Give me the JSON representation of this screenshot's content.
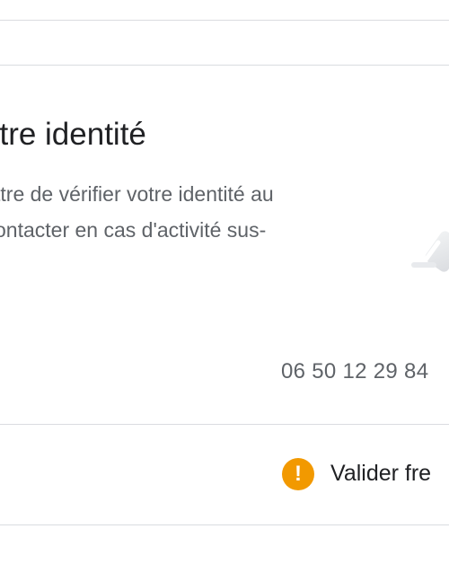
{
  "card": {
    "title": "otre identité",
    "description_lines": [
      "ttre de vérifier votre identité au",
      "ontacter en cas d'activité sus-"
    ],
    "illustration_icon": "verified-phone-illustration"
  },
  "recovery_phone": {
    "value": "06 50 12 29 84"
  },
  "alert": {
    "icon": "warning-icon",
    "icon_color": "#f29900",
    "label": "Valider fre"
  }
}
